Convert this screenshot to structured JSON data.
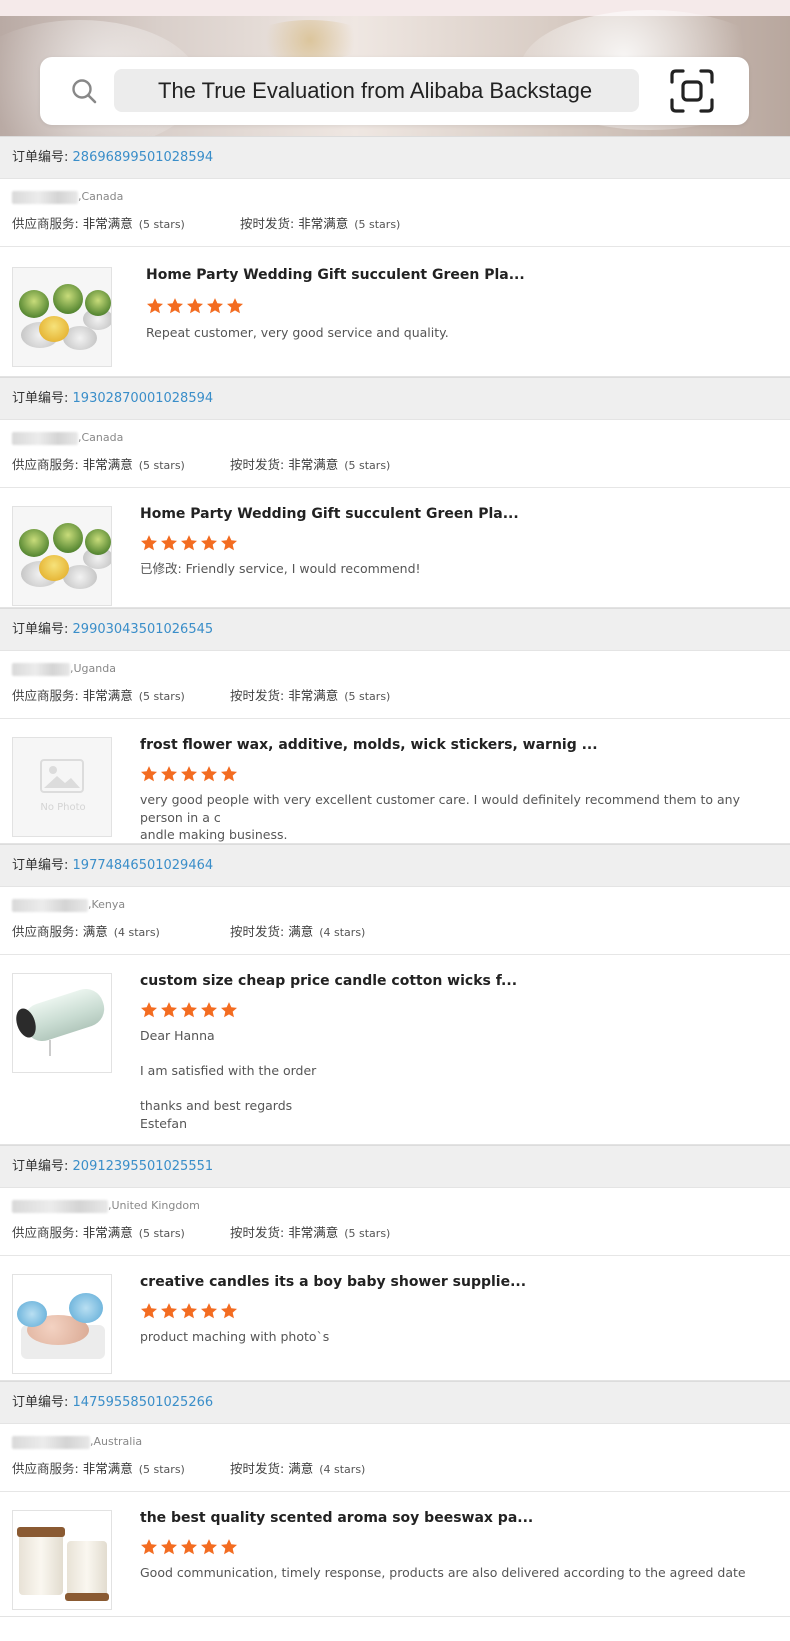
{
  "search": {
    "query": "The True Evaluation from Alibaba Backstage"
  },
  "labels": {
    "order_no": "订单编号:",
    "supplier_service": "供应商服务:",
    "on_time_shipping": "按时发货:"
  },
  "orders": [
    {
      "order_no": "28696899501028594",
      "buyer_country": ",Canada",
      "service_rating": "非常满意",
      "service_stars": "(5 stars)",
      "shipping_rating": "非常满意",
      "shipping_stars": "(5 stars)",
      "product_title": "Home Party Wedding Gift succulent Green Pla...",
      "rating": 5,
      "comment_lines": [
        "Repeat customer, very good service and quality."
      ],
      "thumb": "succulent-candles"
    },
    {
      "order_no": "19302870001028594",
      "buyer_country": ",Canada",
      "service_rating": "非常满意",
      "service_stars": "(5 stars)",
      "shipping_rating": "非常满意",
      "shipping_stars": "(5 stars)",
      "product_title": "Home Party Wedding Gift succulent Green Pla...",
      "rating": 5,
      "comment_lines": [
        "已修改: Friendly service, I would recommend!"
      ],
      "thumb": "succulent-candles"
    },
    {
      "order_no": "29903043501026545",
      "buyer_country": ",Uganda",
      "service_rating": "非常满意",
      "service_stars": "(5 stars)",
      "shipping_rating": "非常满意",
      "shipping_stars": "(5 stars)",
      "product_title": "frost flower wax, additive, molds, wick stickers, warnig ...",
      "rating": 5,
      "comment_lines": [
        "very good people with very excellent customer care. I would definitely recommend them to any person in a c",
        "andle making business."
      ],
      "thumb": "no-photo",
      "no_photo_label": "No Photo"
    },
    {
      "order_no": "19774846501029464",
      "buyer_country": ",Kenya",
      "service_rating": "满意",
      "service_stars": "(4 stars)",
      "shipping_rating": "满意",
      "shipping_stars": "(4 stars)",
      "product_title": "custom size cheap price candle cotton wicks f...",
      "rating": 5,
      "comment_lines": [
        "Dear Hanna",
        "",
        "I am satisfied with the order",
        "",
        "thanks and best regards",
        "Estefan"
      ],
      "thumb": "wick-spool"
    },
    {
      "order_no": "20912395501025551",
      "buyer_country": ",United Kingdom",
      "service_rating": "非常满意",
      "service_stars": "(5 stars)",
      "shipping_rating": "非常满意",
      "shipping_stars": "(5 stars)",
      "product_title": "creative candles its a boy baby shower supplie...",
      "rating": 5,
      "comment_lines": [
        "product maching with photo`s"
      ],
      "thumb": "baby-candle"
    },
    {
      "order_no": "14759558501025266",
      "buyer_country": ",Australia",
      "service_rating": "非常满意",
      "service_stars": "(5 stars)",
      "shipping_rating": "满意",
      "shipping_stars": "(4 stars)",
      "product_title": "the best quality scented aroma soy beeswax pa...",
      "rating": 5,
      "comment_lines": [
        "Good communication, timely response, products are also delivered according to the agreed date"
      ],
      "thumb": "jar-candles"
    }
  ],
  "colors": {
    "order_number": "#3a8ec9",
    "star": "#f36c21",
    "header_bg": "#efefef"
  }
}
